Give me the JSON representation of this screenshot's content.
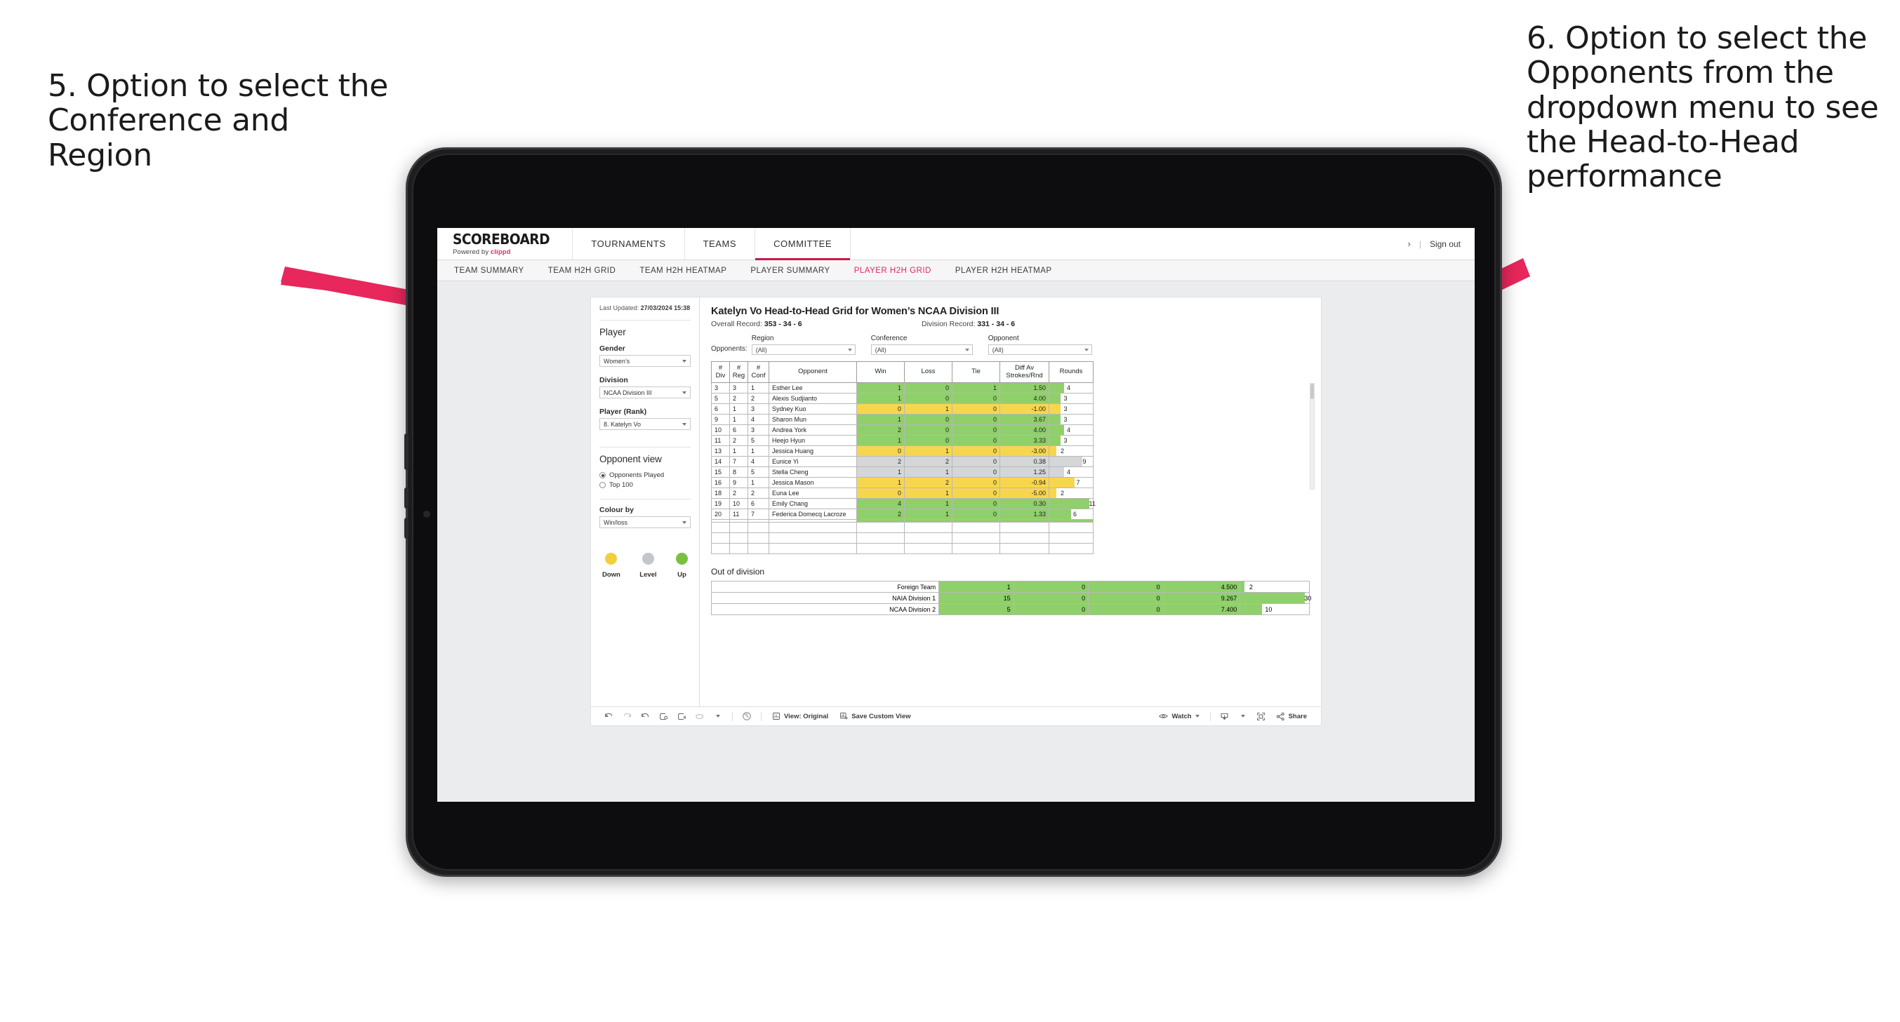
{
  "annotations": {
    "left": "5. Option to select the Conference and Region",
    "right": "6. Option to select the Opponents from the dropdown menu to see the Head-to-Head performance",
    "arrow_color": "#e8275c"
  },
  "app": {
    "brand": {
      "name": "SCOREBOARD",
      "powered_prefix": "Powered by",
      "powered_brand": "clippd"
    },
    "top_nav": [
      {
        "label": "TOURNAMENTS",
        "active": false
      },
      {
        "label": "TEAMS",
        "active": false
      },
      {
        "label": "COMMITTEE",
        "active": true
      }
    ],
    "top_right": {
      "chevron": "›",
      "divider": "|",
      "sign_out": "Sign out"
    },
    "sub_nav": [
      {
        "label": "TEAM SUMMARY",
        "active": false
      },
      {
        "label": "TEAM H2H GRID",
        "active": false
      },
      {
        "label": "TEAM H2H HEATMAP",
        "active": false
      },
      {
        "label": "PLAYER SUMMARY",
        "active": false
      },
      {
        "label": "PLAYER H2H GRID",
        "active": true
      },
      {
        "label": "PLAYER H2H HEATMAP",
        "active": false
      }
    ]
  },
  "pane": {
    "last_updated_label": "Last Updated:",
    "last_updated_value": "27/03/2024 15:38",
    "player_section_title": "Player",
    "fields": [
      {
        "label": "Gender",
        "value": "Women’s"
      },
      {
        "label": "Division",
        "value": "NCAA Division III"
      },
      {
        "label": "Player (Rank)",
        "value": "8. Katelyn Vo"
      }
    ],
    "opponent_view": {
      "title": "Opponent view",
      "options": [
        {
          "label": "Opponents Played",
          "selected": true
        },
        {
          "label": "Top 100",
          "selected": false
        }
      ]
    },
    "colour_by": {
      "label": "Colour by",
      "value": "Win/loss"
    },
    "legend": [
      {
        "name": "Down",
        "color": "#f2cf3c"
      },
      {
        "name": "Level",
        "color": "#c3c7cb"
      },
      {
        "name": "Up",
        "color": "#7ac143"
      }
    ]
  },
  "main": {
    "title": "Katelyn Vo Head-to-Head Grid for Women’s NCAA Division III",
    "overall_record_label": "Overall Record:",
    "overall_record_value": "353 -  34 - 6",
    "division_record_label": "Division Record:",
    "division_record_value": "331 -  34 - 6",
    "opponents_label": "Opponents:",
    "filters": [
      {
        "label": "Region",
        "value": "(All)"
      },
      {
        "label": "Conference",
        "value": "(All)"
      },
      {
        "label": "Opponent",
        "value": "(All)"
      }
    ]
  },
  "chart_data": {
    "type": "table",
    "title": "Katelyn Vo Head-to-Head Grid for Women’s NCAA Division III",
    "columns": [
      "# Div",
      "# Reg",
      "# Conf",
      "Opponent",
      "Win",
      "Loss",
      "Tie",
      "Diff Av Strokes/Rnd",
      "Rounds"
    ],
    "column_headers_multiline": [
      [
        "#",
        "Div"
      ],
      [
        "#",
        "Reg"
      ],
      [
        "#",
        "Conf"
      ],
      [
        "Opponent"
      ],
      [
        "Win"
      ],
      [
        "Loss"
      ],
      [
        "Tie"
      ],
      [
        "Diff Av",
        "Strokes/Rnd"
      ],
      [
        "Rounds"
      ]
    ],
    "rows": [
      {
        "div": "3",
        "reg": "3",
        "conf": "1",
        "opponent": "Esther Lee",
        "win": "1",
        "loss": "0",
        "tie": "1",
        "diff": "1.50",
        "rounds": "4",
        "status": "up"
      },
      {
        "div": "5",
        "reg": "2",
        "conf": "2",
        "opponent": "Alexis Sudjianto",
        "win": "1",
        "loss": "0",
        "tie": "0",
        "diff": "4.00",
        "rounds": "3",
        "status": "up"
      },
      {
        "div": "6",
        "reg": "1",
        "conf": "3",
        "opponent": "Sydney Kuo",
        "win": "0",
        "loss": "1",
        "tie": "0",
        "diff": "-1.00",
        "rounds": "3",
        "status": "down"
      },
      {
        "div": "9",
        "reg": "1",
        "conf": "4",
        "opponent": "Sharon Mun",
        "win": "1",
        "loss": "0",
        "tie": "0",
        "diff": "3.67",
        "rounds": "3",
        "status": "up"
      },
      {
        "div": "10",
        "reg": "6",
        "conf": "3",
        "opponent": "Andrea York",
        "win": "2",
        "loss": "0",
        "tie": "0",
        "diff": "4.00",
        "rounds": "4",
        "status": "up"
      },
      {
        "div": "11",
        "reg": "2",
        "conf": "5",
        "opponent": "Heejo Hyun",
        "win": "1",
        "loss": "0",
        "tie": "0",
        "diff": "3.33",
        "rounds": "3",
        "status": "up"
      },
      {
        "div": "13",
        "reg": "1",
        "conf": "1",
        "opponent": "Jessica Huang",
        "win": "0",
        "loss": "1",
        "tie": "0",
        "diff": "-3.00",
        "rounds": "2",
        "status": "down"
      },
      {
        "div": "14",
        "reg": "7",
        "conf": "4",
        "opponent": "Eunice Yi",
        "win": "2",
        "loss": "2",
        "tie": "0",
        "diff": "0.38",
        "rounds": "9",
        "status": "level"
      },
      {
        "div": "15",
        "reg": "8",
        "conf": "5",
        "opponent": "Stella Cheng",
        "win": "1",
        "loss": "1",
        "tie": "0",
        "diff": "1.25",
        "rounds": "4",
        "status": "level"
      },
      {
        "div": "16",
        "reg": "9",
        "conf": "1",
        "opponent": "Jessica Mason",
        "win": "1",
        "loss": "2",
        "tie": "0",
        "diff": "-0.94",
        "rounds": "7",
        "status": "down"
      },
      {
        "div": "18",
        "reg": "2",
        "conf": "2",
        "opponent": "Euna Lee",
        "win": "0",
        "loss": "1",
        "tie": "0",
        "diff": "-5.00",
        "rounds": "2",
        "status": "down"
      },
      {
        "div": "19",
        "reg": "10",
        "conf": "6",
        "opponent": "Emily Chang",
        "win": "4",
        "loss": "1",
        "tie": "0",
        "diff": "0.30",
        "rounds": "11",
        "status": "up"
      },
      {
        "div": "20",
        "reg": "11",
        "conf": "7",
        "opponent": "Federica Domecq Lacroze",
        "win": "2",
        "loss": "1",
        "tie": "0",
        "diff": "1.33",
        "rounds": "6",
        "status": "up"
      }
    ],
    "rounds_max": 12,
    "out_of_division": {
      "title": "Out of division",
      "rows": [
        {
          "name": "Foreign Team",
          "win": "1",
          "loss": "0",
          "tie": "0",
          "diff": "4.500",
          "rounds": "2",
          "status": "up"
        },
        {
          "name": "NAIA Division 1",
          "win": "15",
          "loss": "0",
          "tie": "0",
          "diff": "9.267",
          "rounds": "30",
          "status": "up"
        },
        {
          "name": "NCAA Division 2",
          "win": "5",
          "loss": "0",
          "tie": "0",
          "diff": "7.400",
          "rounds": "10",
          "status": "up"
        }
      ],
      "rounds_max": 32
    },
    "colors": {
      "up": "#8fd06a",
      "down": "#f7d64f",
      "level": "#d4d6d8",
      "white": "#ffffff"
    }
  },
  "toolbar": {
    "icons": [
      "undo-icon",
      "redo-icon",
      "revert-icon",
      "refresh-icon",
      "pause-icon",
      "highlight-icon"
    ],
    "view_label": "View: Original",
    "save_label": "Save Custom View",
    "watch_label": "Watch",
    "share_label": "Share"
  }
}
